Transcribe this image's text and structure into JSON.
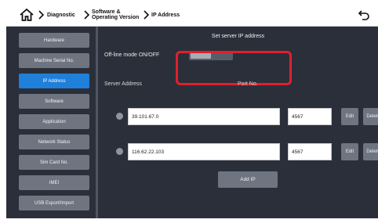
{
  "header": {
    "breadcrumb": [
      {
        "label": "Diagnostic"
      },
      {
        "label_line1": "Software &",
        "label_line2": "Operating Version"
      },
      {
        "label": "IP Address"
      }
    ]
  },
  "sidebar": {
    "items": [
      {
        "label": "Hardware"
      },
      {
        "label": "Machine Serial No."
      },
      {
        "label": "IP Address",
        "active": true
      },
      {
        "label": "Software"
      },
      {
        "label": "Application"
      },
      {
        "label": "Network Status"
      },
      {
        "label": "Sim Card No."
      },
      {
        "label": "IMEI"
      },
      {
        "label": "USB Export/Import"
      }
    ]
  },
  "main": {
    "title": "Set server IP address",
    "offline_mode_label": "Off-line mode ON/OFF",
    "offline_mode_state": "off",
    "server_address_label": "Server Address",
    "port_label": "Port No.",
    "servers": [
      {
        "address": "39.101.67.0",
        "port": "4567",
        "edit_label": "Edit",
        "delete_label": "Delete"
      },
      {
        "address": "116.62.22.103",
        "port": "4567",
        "edit_label": "Edit",
        "delete_label": "Delete"
      }
    ],
    "add_ip_label": "Add IP"
  },
  "colors": {
    "panel_background": "#2b2f3a",
    "button_gray": "#6e7480",
    "active_blue": "#1f7fd9",
    "highlight_red": "#e0202e"
  }
}
